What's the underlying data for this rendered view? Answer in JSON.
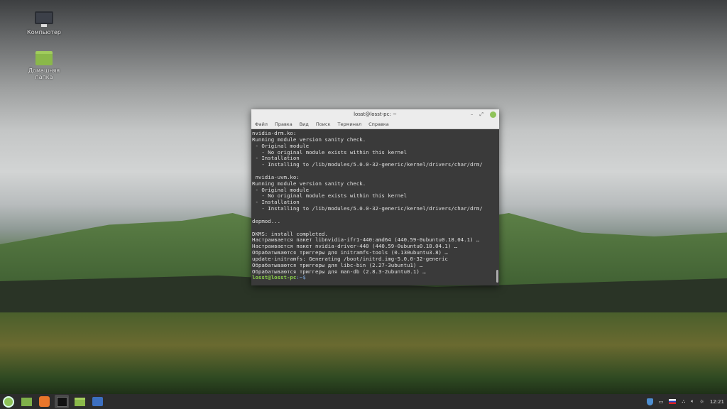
{
  "desktop": {
    "icons": [
      {
        "label": "Компьютер",
        "icon": "computer-icon"
      },
      {
        "label": "Домашняя папка",
        "icon": "home-folder-icon"
      }
    ]
  },
  "terminal": {
    "title": "losst@losst-pc: ~",
    "menu": [
      "Файл",
      "Правка",
      "Вид",
      "Поиск",
      "Терминал",
      "Справка"
    ],
    "lines": [
      "nvidia-drm.ko:",
      "Running module version sanity check.",
      " - Original module",
      "   - No original module exists within this kernel",
      " - Installation",
      "   - Installing to /lib/modules/5.0.0-32-generic/kernel/drivers/char/drm/",
      "",
      " nvidia-uvm.ko:",
      "Running module version sanity check.",
      " - Original module",
      "   - No original module exists within this kernel",
      " - Installation",
      "   - Installing to /lib/modules/5.0.0-32-generic/kernel/drivers/char/drm/",
      "",
      "depmod...",
      "",
      "DKMS: install completed.",
      "Настраивается пакет libnvidia-ifr1-440:amd64 (440.59-0ubuntu0.18.04.1) …",
      "Настраивается пакет nvidia-driver-440 (440.59-0ubuntu0.18.04.1) …",
      "Обрабатываются триггеры для initramfs-tools (0.130ubuntu3.8) …",
      "update-initramfs: Generating /boot/initrd.img-5.0.0-32-generic",
      "Обрабатываются триггеры для libc-bin (2.27-3ubuntu1) …",
      "Обрабатываются триггеры для man-db (2.8.3-2ubuntu0.1) …"
    ],
    "prompt": "losst@losst-pc",
    "prompt_suffix": ":~$"
  },
  "taskbar": {
    "apps": [
      "mint-menu-icon",
      "show-desktop-icon",
      "firefox-icon",
      "terminal-icon",
      "files-icon",
      "screenshot-icon"
    ],
    "clock": "12:21",
    "accent": "#8fc35a"
  }
}
